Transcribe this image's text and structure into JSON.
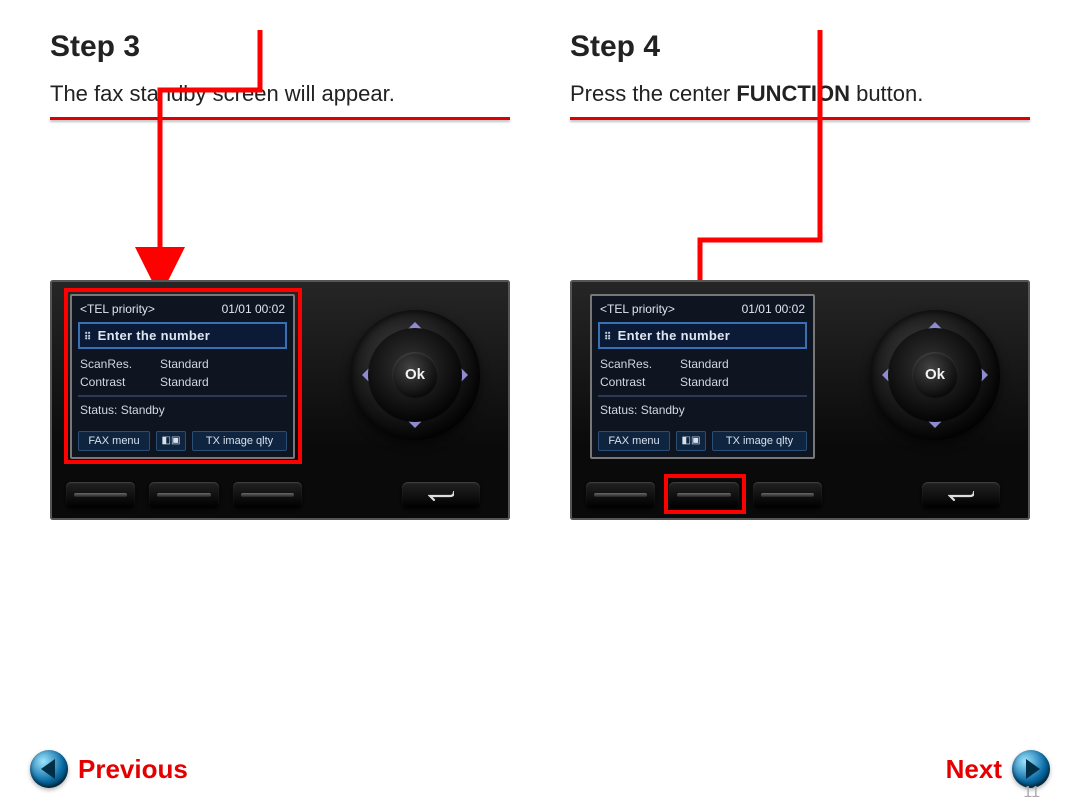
{
  "page_number": "11",
  "nav": {
    "prev": "Previous",
    "next": "Next"
  },
  "steps": [
    {
      "title": "Step 3",
      "desc_plain": "The fax standby screen will appear.",
      "desc_html": "The fax standby screen will appear."
    },
    {
      "title": "Step 4",
      "desc_plain": "Press the center FUNCTION button.",
      "desc_html": "Press the center <b>FUNCTION</b> button."
    }
  ],
  "lcd": {
    "header_left": "<TEL priority>",
    "header_right": "01/01 00:02",
    "entry": "Enter the number",
    "rows": [
      {
        "k": "ScanRes.",
        "v": "Standard"
      },
      {
        "k": "Contrast",
        "v": "Standard"
      }
    ],
    "status": "Status: Standby",
    "tabs": {
      "left": "FAX menu",
      "mid": "◧▣",
      "right": "TX image qlty"
    }
  },
  "ok_label": "Ok"
}
